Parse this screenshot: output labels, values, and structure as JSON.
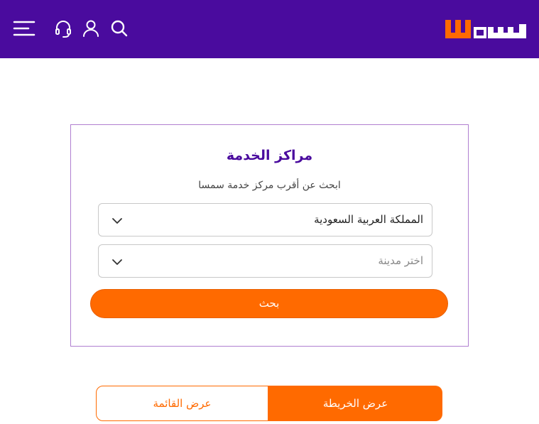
{
  "brand": {
    "logo_text": "سمسا",
    "header_color": "#4a0b9e",
    "accent_color": "#ff6a00"
  },
  "header": {
    "icons": [
      "menu-icon",
      "headset-icon",
      "user-icon",
      "search-icon"
    ]
  },
  "service_centers": {
    "title": "مراكز الخدمة",
    "subtitle": "ابحث عن أقرب مركز خدمة سمسا",
    "country_select": {
      "value": "المملكة العربية السعودية"
    },
    "city_select": {
      "placeholder": "اختر مدينة"
    },
    "search_button": "بحث"
  },
  "view_toggle": {
    "map_label": "عرض الخريطة",
    "list_label": "عرض القائمة",
    "active": "map"
  }
}
